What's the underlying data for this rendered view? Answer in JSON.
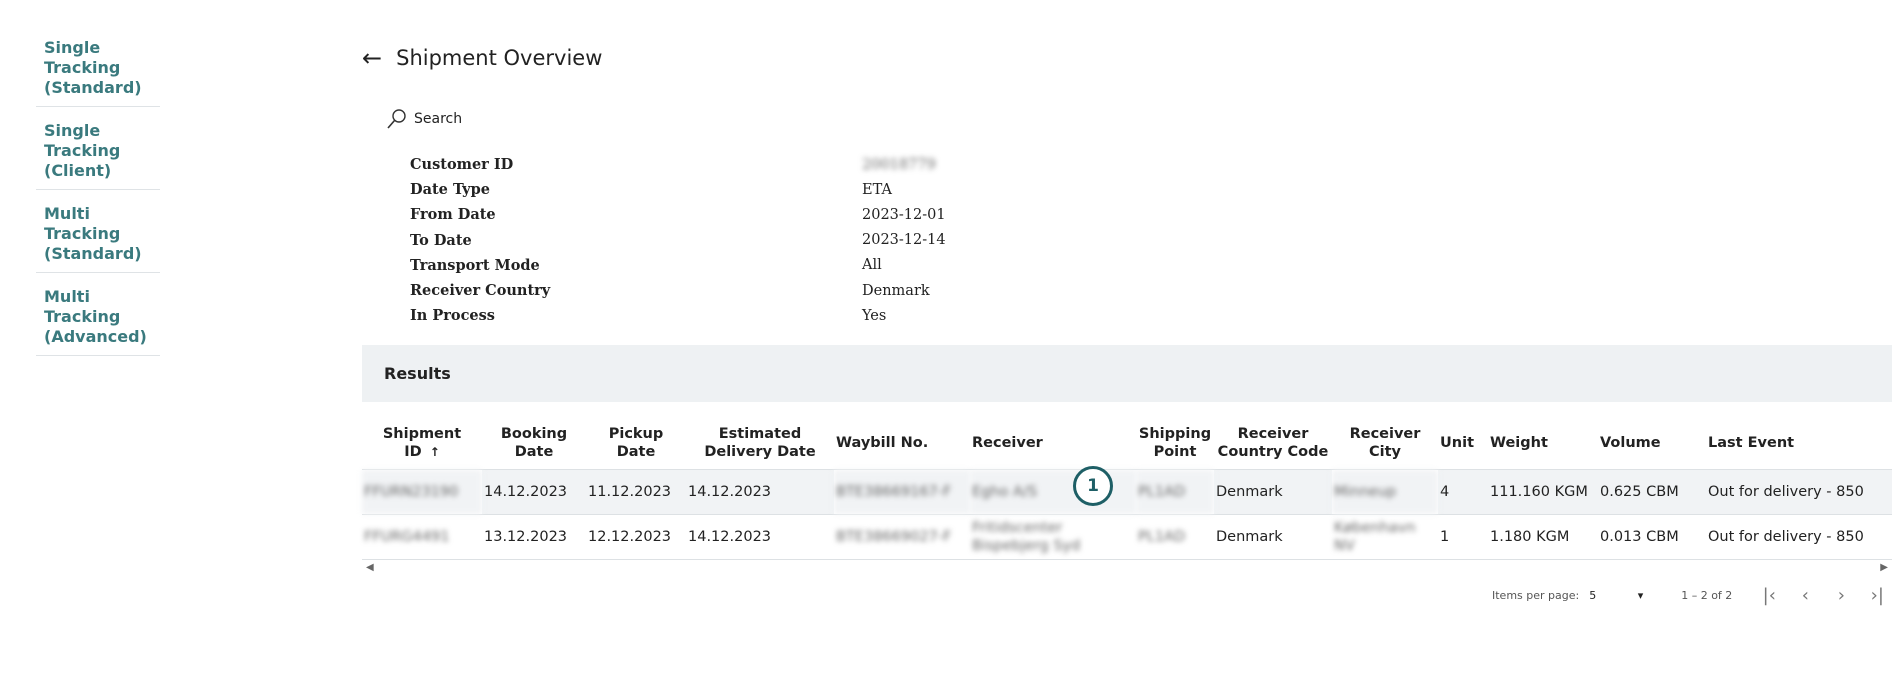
{
  "sidebar": {
    "items": [
      {
        "label": "Single Tracking (Standard)"
      },
      {
        "label": "Single Tracking (Client)"
      },
      {
        "label": "Multi Tracking (Standard)"
      },
      {
        "label": "Multi Tracking (Advanced)"
      }
    ]
  },
  "header": {
    "back_icon": "arrow-left-icon",
    "title": "Shipment Overview"
  },
  "search": {
    "icon": "search-icon",
    "label": "Search"
  },
  "filters": [
    {
      "label": "Customer ID",
      "value": "20018779"
    },
    {
      "label": "Date Type",
      "value": "ETA"
    },
    {
      "label": "From Date",
      "value": "2023-12-01"
    },
    {
      "label": "To Date",
      "value": "2023-12-14"
    },
    {
      "label": "Transport Mode",
      "value": "All"
    },
    {
      "label": "Receiver Country",
      "value": "Denmark"
    },
    {
      "label": "In Process",
      "value": "Yes"
    }
  ],
  "results": {
    "title": "Results",
    "columns": [
      "Shipment ID",
      "Booking Date",
      "Pickup Date",
      "Estimated Delivery Date",
      "Waybill No.",
      "Receiver",
      "Shipping Point",
      "Receiver Country Code",
      "Receiver City",
      "Unit",
      "Weight",
      "Volume",
      "Last Event"
    ],
    "sort_icon": "arrow-up-icon",
    "rows": [
      [
        "FFURN23190",
        "14.12.2023",
        "11.12.2023",
        "14.12.2023",
        "BTE38669167-F",
        "Egho A/S",
        "PL1AD",
        "Denmark",
        "Minneup",
        "4",
        "111.160 KGM",
        "0.625 CBM",
        "Out for delivery - 850"
      ],
      [
        "FFURG4491",
        "13.12.2023",
        "12.12.2023",
        "14.12.2023",
        "BTE38669027-F",
        "Fritidscenter Bispebjerg Syd",
        "PL1AD",
        "Denmark",
        "København NV",
        "1",
        "1.180 KGM",
        "0.013 CBM",
        "Out for delivery - 850"
      ]
    ]
  },
  "annotation": {
    "badge": "1"
  },
  "pagination": {
    "items_per_page_label": "Items per page:",
    "items_per_page_value": "5",
    "range": "1 – 2 of 2",
    "icons": [
      "first-page-icon",
      "previous-page-icon",
      "next-page-icon",
      "last-page-icon"
    ]
  },
  "colors": {
    "accent": "#3a7a7e",
    "badge": "#1e5f66",
    "results_bg": "#eef1f3"
  }
}
